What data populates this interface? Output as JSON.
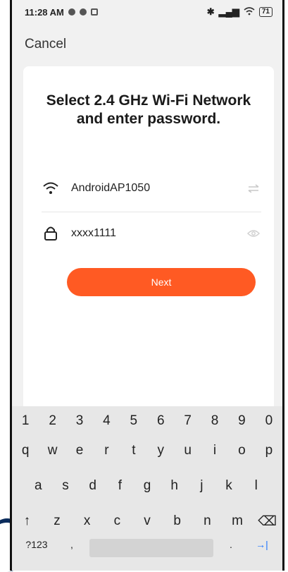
{
  "statusbar": {
    "time": "11:28 AM",
    "battery": "71"
  },
  "header": {
    "cancel_label": "Cancel"
  },
  "card": {
    "title": "Select 2.4 GHz Wi-Fi Network and enter password.",
    "wifi_network": "AndroidAP1050",
    "password_value": "xxxx1111",
    "next_label": "Next"
  },
  "keyboard": {
    "row1": [
      "1",
      "2",
      "3",
      "4",
      "5",
      "6",
      "7",
      "8",
      "9",
      "0"
    ],
    "row2": [
      "q",
      "w",
      "e",
      "r",
      "t",
      "y",
      "u",
      "i",
      "o",
      "p"
    ],
    "row3": [
      "a",
      "s",
      "d",
      "f",
      "g",
      "h",
      "j",
      "k",
      "l"
    ],
    "row4": [
      "↑",
      "z",
      "x",
      "c",
      "v",
      "b",
      "n",
      "m",
      "⌫"
    ],
    "bottom_left": "?123",
    "comma": ",",
    "period": ".",
    "enter": "→|"
  },
  "colors": {
    "accent": "#ff5a23",
    "enter_key": "#1e74ff"
  }
}
